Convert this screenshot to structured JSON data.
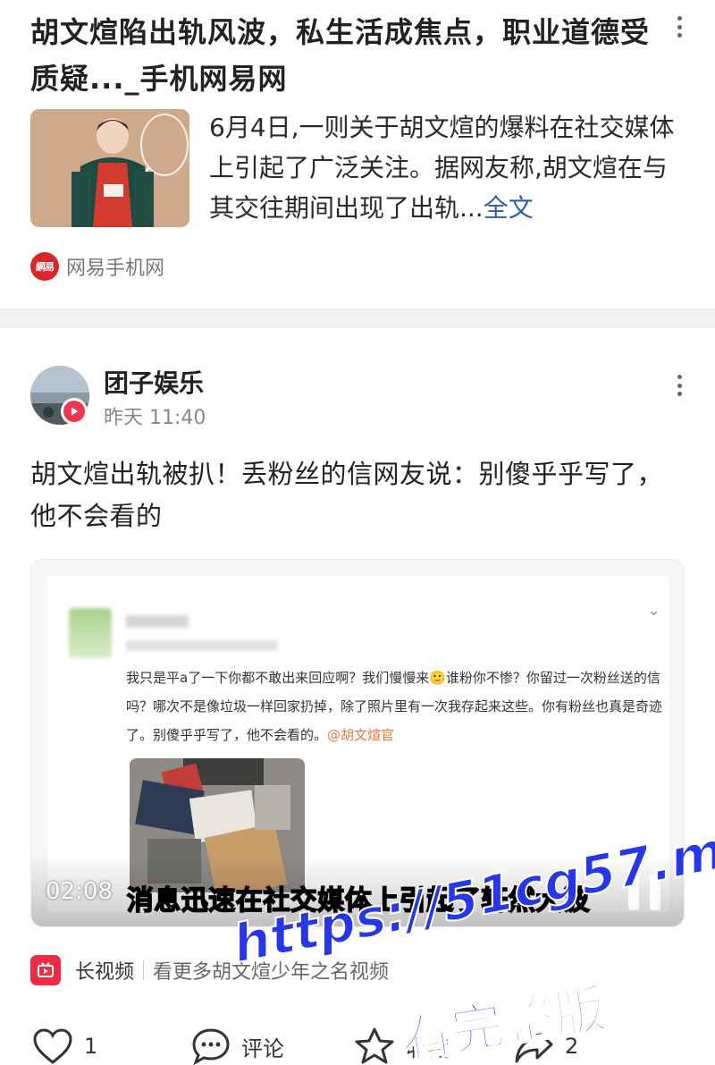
{
  "news": {
    "title": "胡文煊陷出轨风波，私生活成焦点，职业道德受质疑..._手机网易网",
    "summary": "6月4日,一则关于胡文煊的爆料在社交媒体上引起了广泛关注。据网友称,胡文煊在与其交往期间出现了出轨...",
    "full_link": "全文",
    "source_logo_text": "網易",
    "source_name": "网易手机网"
  },
  "post": {
    "author": "团子娱乐",
    "time": "昨天 11:40",
    "text": "胡文煊出轨被扒！丢粉丝的信网友说：别傻乎乎写了，他不会看的",
    "video": {
      "duration": "02:08",
      "subtitle": "消息迅速在社交媒体上引起了轩然大波",
      "weibo_text": "我只是平a了一下你都不敢出来回应啊？我们慢慢来🙂谁粉你不惨？你留过一次粉丝送的信吗？哪次不是像垃圾一样回家扔掉，除了照片里有一次我存起来这些。你有粉丝也真是奇迹了。别傻乎乎写了，他不会看的。",
      "weibo_mention": "@胡文煊官"
    },
    "long_video_label": "长视频",
    "long_video_more": "看更多胡文煊少年之名视频",
    "actions": {
      "like_count": "1",
      "comment_label": "评论",
      "favorite_label": "收藏",
      "share_count": "2"
    }
  },
  "watermark": {
    "url": "https://51cg57.me",
    "subtitle": "看完整版"
  },
  "colors": {
    "link": "#2a5ea8",
    "brand_red": "#d8262c",
    "video_red": "#f02b46",
    "watermark_blue": "#2637e8"
  }
}
